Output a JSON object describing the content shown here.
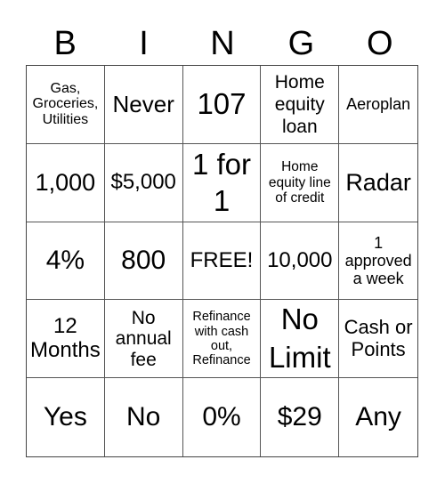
{
  "header": {
    "letters": [
      "B",
      "I",
      "N",
      "G",
      "O"
    ]
  },
  "cells": [
    "Gas, Groceries, Utilities",
    "Never",
    "107",
    "Home equity loan",
    "Aeroplan",
    "1,000",
    "$5,000",
    "1 for 1",
    "Home equity line of credit",
    "Radar",
    "4%",
    "800",
    "FREE!",
    "10,000",
    "1 approved a week",
    "12 Months",
    "No annual fee",
    "Refinance with cash out, Refinance",
    "No Limit",
    "Cash or Points",
    "Yes",
    "No",
    "0%",
    "$29",
    "Any"
  ]
}
